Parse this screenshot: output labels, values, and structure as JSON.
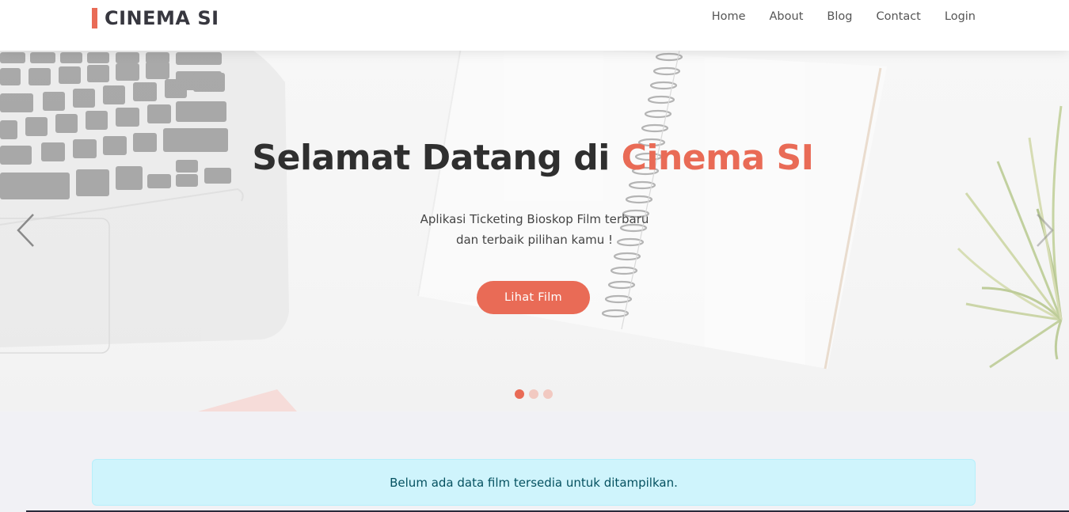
{
  "brand": {
    "name": "CINEMA SI",
    "accent_color": "#e96b56"
  },
  "nav": {
    "items": [
      {
        "label": "Home"
      },
      {
        "label": "About"
      },
      {
        "label": "Blog"
      },
      {
        "label": "Contact"
      },
      {
        "label": "Login"
      }
    ]
  },
  "hero": {
    "title_prefix": "Selamat Datang di ",
    "title_accent": "Cinema SI",
    "subtitle_line1": "Aplikasi Ticketing Bioskop Film terbaru",
    "subtitle_line2": "dan terbaik pilihan kamu !",
    "cta_label": "Lihat Film",
    "prev_icon": "chevron-left-icon",
    "next_icon": "chevron-right-icon",
    "slides_count": 3,
    "active_slide": 1
  },
  "main": {
    "alert_text": "Belum ada data film tersedia untuk ditampilkan."
  },
  "colors": {
    "accent": "#e96b56",
    "alert_bg": "#cff4fc",
    "alert_text": "#055160"
  }
}
